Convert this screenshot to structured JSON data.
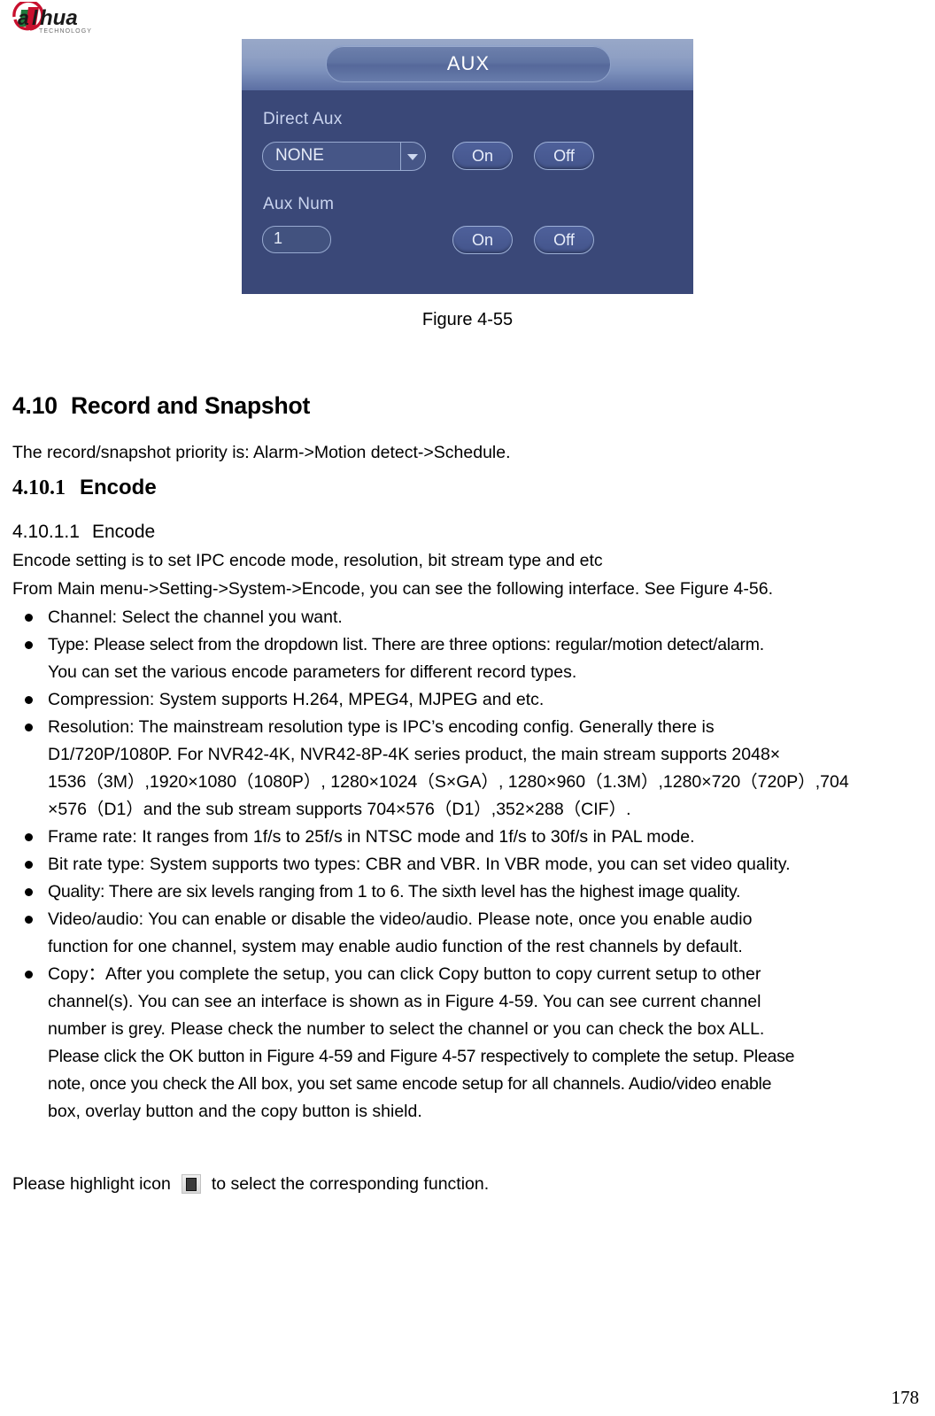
{
  "header": {
    "logo_text": "alhua",
    "logo_subtext": "TECHNOLOGY"
  },
  "figure": {
    "dialog": {
      "title": "AUX",
      "direct_aux_label": "Direct Aux",
      "direct_aux_value": "NONE",
      "direct_aux_on": "On",
      "direct_aux_off": "Off",
      "aux_num_label": "Aux Num",
      "aux_num_value": "1",
      "aux_num_on": "On",
      "aux_num_off": "Off"
    },
    "caption": "Figure 4-55"
  },
  "sections": {
    "h2_number": "4.10",
    "h2_title": "Record and Snapshot",
    "priority_text": "The record/snapshot priority is: Alarm->Motion detect->Schedule.",
    "h3_number": "4.10.1",
    "h3_title": "Encode",
    "h4_number": "4.10.1.1",
    "h4_title": "Encode",
    "encode_line1": "Encode setting is to set IPC encode mode, resolution, bit stream type and etc",
    "encode_line2": "From Main menu->Setting->System->Encode, you can see the following interface. See Figure 4-56."
  },
  "bullets": [
    {
      "lines": [
        "Channel: Select the channel you want."
      ]
    },
    {
      "lines": [
        "Type: Please select from the dropdown list. There are three options: regular/motion detect/alarm.",
        "You can set the various encode parameters for different record types."
      ]
    },
    {
      "lines": [
        "Compression: System supports H.264, MPEG4, MJPEG and etc."
      ]
    },
    {
      "lines": [
        "Resolution: The mainstream resolution type is IPC’s encoding config. Generally there is",
        "D1/720P/1080P. For NVR42-4K, NVR42-8P-4K series product, the main stream supports 2048×",
        "1536（3M）,1920×1080（1080P）, 1280×1024（S×GA）, 1280×960（1.3M）,1280×720（720P）,704",
        "×576（D1）and the sub stream supports 704×576（D1）,352×288（CIF）."
      ]
    },
    {
      "lines": [
        "Frame rate: It ranges from 1f/s to 25f/s in NTSC mode and 1f/s to 30f/s in PAL mode."
      ]
    },
    {
      "lines": [
        "Bit rate type: System supports two types: CBR and VBR. In VBR mode, you can set video quality."
      ]
    },
    {
      "lines": [
        "Quality: There are six levels ranging from 1 to 6. The sixth level has the highest image quality."
      ]
    },
    {
      "lines": [
        "Video/audio: You can enable or disable the video/audio. Please note, once you enable audio",
        "function for one channel, system may enable audio function of the rest channels by default."
      ]
    },
    {
      "lines": [
        "Copy：After you complete the setup, you can click Copy button to copy current setup to other",
        "channel(s). You can see an interface is shown as in Figure 4-59. You can see current channel",
        "number is grey. Please check the number to select the channel or you can check the box ALL.",
        "Please click the OK button in Figure 4-59 and Figure 4-57 respectively to complete the setup. Please",
        "note, once you check the All box, you set same encode setup for all channels. Audio/video enable",
        "box, overlay button and the copy button is shield."
      ]
    }
  ],
  "highlight": {
    "before_icon": "Please highlight icon",
    "after_icon": "to select the corresponding function."
  },
  "footer": {
    "page_number": "178"
  }
}
